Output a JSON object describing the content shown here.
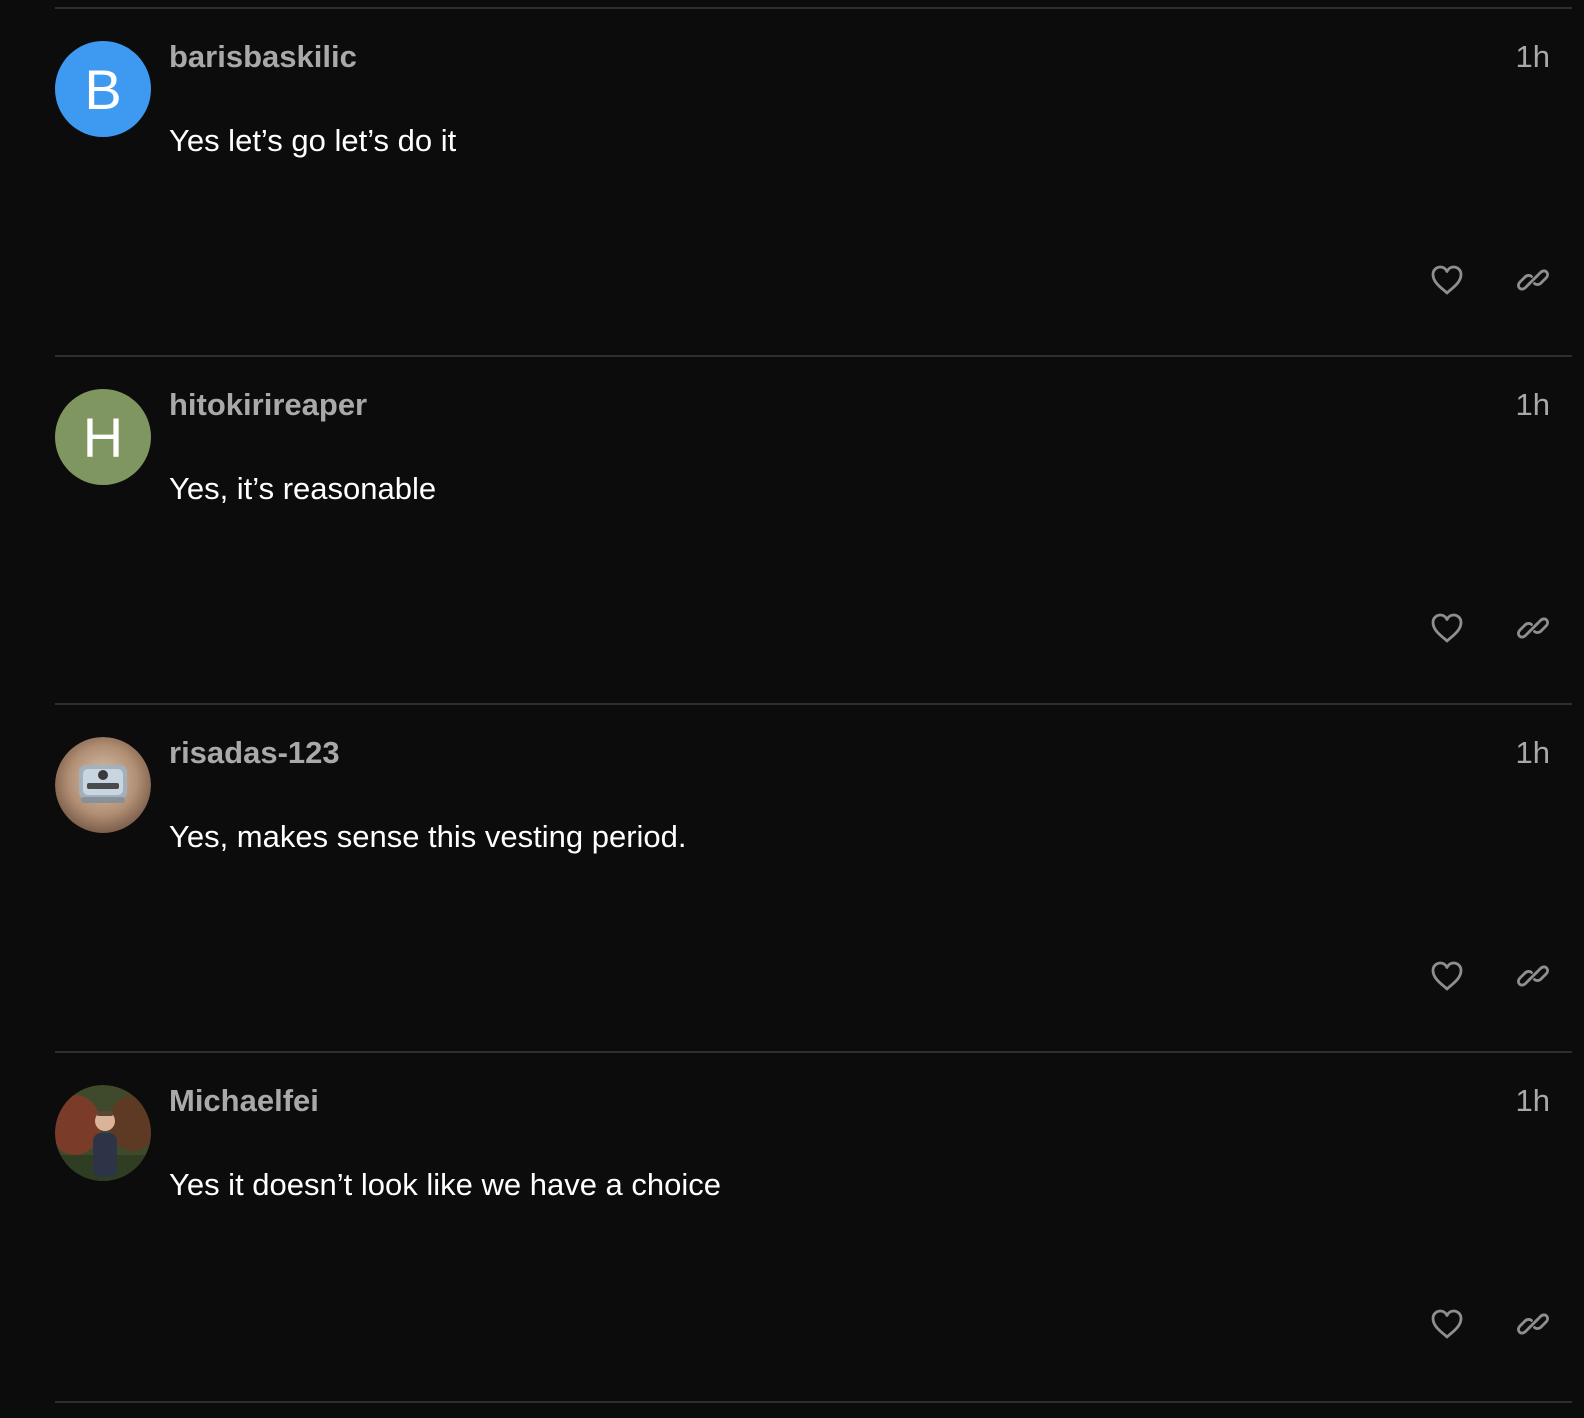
{
  "posts": [
    {
      "username": "barisbaskilic",
      "time": "1h",
      "body": "Yes let’s go let’s do it",
      "avatar": {
        "type": "letter",
        "letter": "B",
        "color": "#3d9af0"
      }
    },
    {
      "username": "hitokirireaper",
      "time": "1h",
      "body": "Yes, it’s reasonable",
      "avatar": {
        "type": "letter",
        "letter": "H",
        "color": "#7f9660"
      }
    },
    {
      "username": "risadas-123",
      "time": "1h",
      "body": "Yes, makes sense this vesting period.",
      "avatar": {
        "type": "photo",
        "description": "product-photo"
      }
    },
    {
      "username": "Michaelfei",
      "time": "1h",
      "body": "Yes it doesn’t look like we have a choice",
      "avatar": {
        "type": "photo",
        "description": "person-photo"
      }
    }
  ],
  "icons": {
    "like": "heart-icon",
    "link": "link-icon"
  },
  "colors": {
    "background": "#0c0c0c",
    "username": "#a9a9a9",
    "body_text": "#ffffff",
    "divider": "#2e2e2e"
  }
}
